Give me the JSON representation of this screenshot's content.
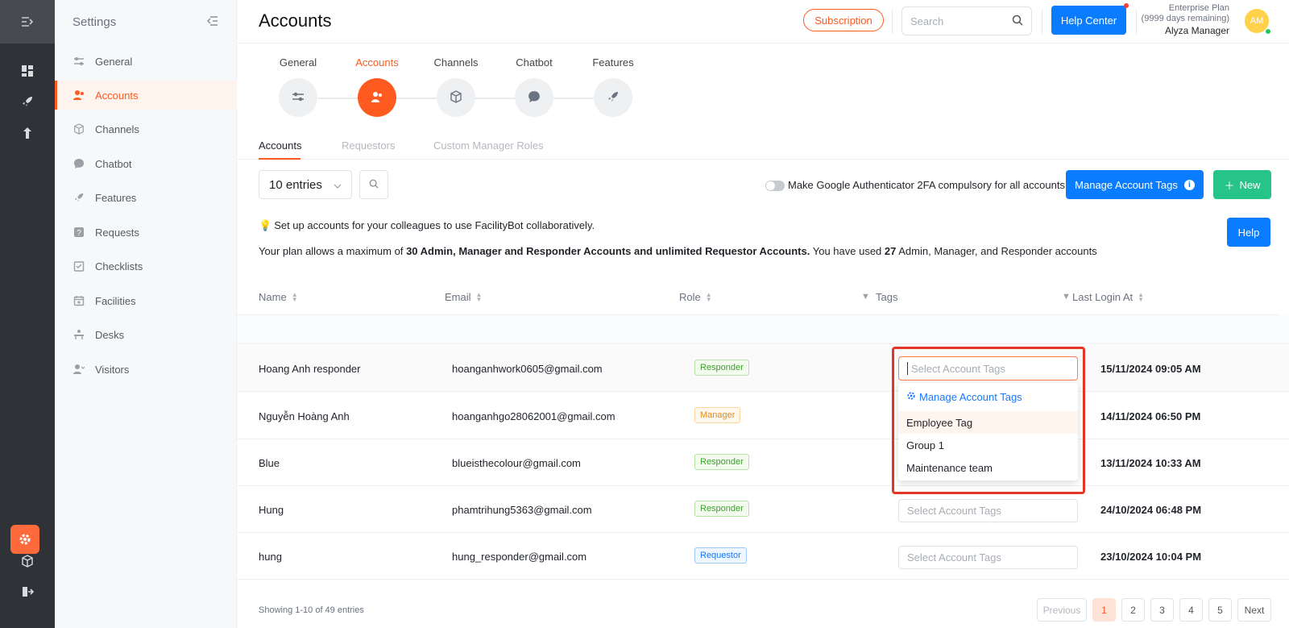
{
  "settings_sidebar": {
    "title": "Settings",
    "items": [
      {
        "label": "General",
        "icon": "sliders-icon"
      },
      {
        "label": "Accounts",
        "icon": "users-icon"
      },
      {
        "label": "Channels",
        "icon": "cube-icon"
      },
      {
        "label": "Chatbot",
        "icon": "chat-icon"
      },
      {
        "label": "Features",
        "icon": "rocket-icon"
      },
      {
        "label": "Requests",
        "icon": "question-icon"
      },
      {
        "label": "Checklists",
        "icon": "checklist-icon"
      },
      {
        "label": "Facilities",
        "icon": "calendar-icon"
      },
      {
        "label": "Desks",
        "icon": "desk-icon"
      },
      {
        "label": "Visitors",
        "icon": "visitor-icon"
      }
    ]
  },
  "header": {
    "title": "Accounts",
    "subscription_label": "Subscription",
    "search_placeholder": "Search",
    "help_center_label": "Help Center",
    "plan_name": "Enterprise Plan",
    "plan_remaining": "(9999 days remaining)",
    "user_name": "Alyza Manager",
    "avatar_initials": "AM"
  },
  "stepper": {
    "steps": [
      {
        "label": "General"
      },
      {
        "label": "Accounts"
      },
      {
        "label": "Channels"
      },
      {
        "label": "Chatbot"
      },
      {
        "label": "Features"
      }
    ],
    "active_step": "Accounts"
  },
  "subtabs": [
    "Accounts",
    "Requestors",
    "Custom Manager Roles"
  ],
  "toolbar": {
    "entries_value": "10 entries",
    "twofa_label": "Make Google Authenticator 2FA compulsory for all accounts",
    "manage_tags_label": "Manage Account Tags",
    "new_label": "New"
  },
  "notes": {
    "line1": "Set up accounts for your colleagues to use FacilityBot collaboratively.",
    "line2_prefix": "Your plan allows a maximum of ",
    "line2_bold1": "30 Admin, Manager and Responder Accounts and unlimited Requestor Accounts.",
    "line2_mid": " You have used ",
    "line2_bold2": "27",
    "line2_suffix": " Admin, Manager, and Responder accounts",
    "help_label": "Help"
  },
  "table": {
    "columns": [
      "Name",
      "Email",
      "Role",
      "Tags",
      "Last Login At"
    ],
    "rows": [
      {
        "name": "Hoang Anh responder",
        "email": "hoanganhwork0605@gmail.com",
        "role": "Responder",
        "tags": "Select Account Tags",
        "last_login": "15/11/2024 09:05 AM"
      },
      {
        "name": "Nguyễn Hoàng Anh",
        "email": "hoanganhgo28062001@gmail.com",
        "role": "Manager",
        "tags": "",
        "last_login": "14/11/2024 06:50 PM"
      },
      {
        "name": "Blue",
        "email": "blueisthecolour@gmail.com",
        "role": "Responder",
        "tags": "",
        "last_login": "13/11/2024 10:33 AM"
      },
      {
        "name": "Hung",
        "email": "phamtrihung5363@gmail.com",
        "role": "Responder",
        "tags": "Select Account Tags",
        "last_login": "24/10/2024 06:48 PM"
      },
      {
        "name": "hung",
        "email": "hung_responder@gmail.com",
        "role": "Requestor",
        "tags": "Select Account Tags",
        "last_login": "23/10/2024 10:04 PM"
      }
    ]
  },
  "tag_dropdown": {
    "manage_label": "Manage Account Tags",
    "options": [
      "Employee Tag",
      "Group 1",
      "Maintenance team"
    ]
  },
  "footer": {
    "showing": "Showing 1-10 of 49 entries",
    "previous": "Previous",
    "pages": [
      "1",
      "2",
      "3",
      "4",
      "5"
    ],
    "next": "Next"
  },
  "colors": {
    "accent": "#ff5a1f",
    "primary_blue": "#0a7cff",
    "new_green": "#27c48a",
    "rail_dark": "#2f3338"
  }
}
